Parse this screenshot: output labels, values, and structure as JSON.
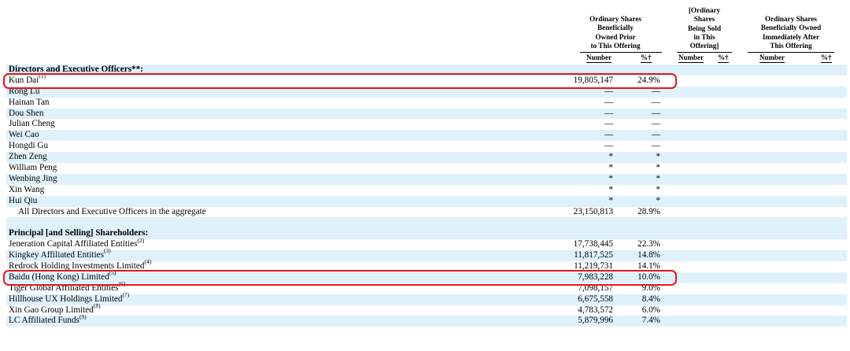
{
  "header": {
    "col1": [
      "Ordinary Shares",
      "Beneficially",
      "Owned Prior",
      "to This Offering"
    ],
    "col2": [
      "[Ordinary",
      "Shares",
      "Being Sold",
      "in This",
      "Offering]"
    ],
    "col3": [
      "Ordinary Shares",
      "Beneficially Owned",
      "Immediately After",
      "This Offering"
    ],
    "sub": {
      "number1": "Number",
      "pct1": "%†",
      "number2": "Number",
      "pct2": "%†",
      "number3": "Number",
      "pct3": "%†"
    }
  },
  "rows": [
    {
      "name": "Directors and Executive Officers**:",
      "sup": "",
      "number": "",
      "pct": "",
      "type": "section",
      "shade": true
    },
    {
      "name": "Kun Dai",
      "sup": "(1)",
      "number": "19,805,147",
      "pct": "24.9%",
      "shade": false,
      "highlight": true
    },
    {
      "name": "Rong Lu",
      "sup": "",
      "number": "—",
      "pct": "—",
      "shade": true
    },
    {
      "name": "Hainan Tan",
      "sup": "",
      "number": "—",
      "pct": "—",
      "shade": false
    },
    {
      "name": "Dou Shen",
      "sup": "",
      "number": "—",
      "pct": "—",
      "shade": true
    },
    {
      "name": "Julian Cheng",
      "sup": "",
      "number": "—",
      "pct": "—",
      "shade": false
    },
    {
      "name": "Wei Cao",
      "sup": "",
      "number": "—",
      "pct": "—",
      "shade": true
    },
    {
      "name": "Hongdi Gu",
      "sup": "",
      "number": "—",
      "pct": "—",
      "shade": false
    },
    {
      "name": "Zhen Zeng",
      "sup": "",
      "number": "*",
      "pct": "*",
      "shade": true
    },
    {
      "name": "William Peng",
      "sup": "",
      "number": "*",
      "pct": "*",
      "shade": false
    },
    {
      "name": "Wenbing Jing",
      "sup": "",
      "number": "*",
      "pct": "*",
      "shade": true
    },
    {
      "name": "Xin Wang",
      "sup": "",
      "number": "*",
      "pct": "*",
      "shade": false
    },
    {
      "name": "Hui Qiu",
      "sup": "",
      "number": "*",
      "pct": "*",
      "shade": true
    },
    {
      "name": "All Directors and Executive Officers in the aggregate",
      "sup": "",
      "number": "23,150,813",
      "pct": "28.9%",
      "shade": false,
      "indent": true
    },
    {
      "name": "",
      "sup": "",
      "number": "",
      "pct": "",
      "shade": true
    },
    {
      "name": "Principal [and Selling] Shareholders:",
      "sup": "",
      "number": "",
      "pct": "",
      "type": "section",
      "shade": true
    },
    {
      "name": "Jeneration Capital Affiliated Entities",
      "sup": "(2)",
      "number": "17,738,445",
      "pct": "22.3%",
      "shade": false
    },
    {
      "name": "Kingkey Affiliated Entities",
      "sup": "(3)",
      "number": "11,817,525",
      "pct": "14.8%",
      "shade": true
    },
    {
      "name": "Redrock Holding Investments Limited",
      "sup": "(4)",
      "number": "11,219,731",
      "pct": "14.1%",
      "shade": false
    },
    {
      "name": "Baidu (Hong Kong) Limited",
      "sup": "(5)",
      "number": "7,983,228",
      "pct": "10.0%",
      "shade": true,
      "highlight": true
    },
    {
      "name": "Tiger Global Affiliated Entities",
      "sup": "(6)",
      "number": "7,098,157",
      "pct": "9.0%",
      "shade": false
    },
    {
      "name": "Hillhouse UX Holdings Limited",
      "sup": "(7)",
      "number": "6,675,558",
      "pct": "8.4%",
      "shade": true
    },
    {
      "name": "Xin Gao Group Limited",
      "sup": "(8)",
      "number": "4,783,572",
      "pct": "6.0%",
      "shade": false
    },
    {
      "name": "LC Affiliated Funds",
      "sup": "(9)",
      "number": "5,879,996",
      "pct": "7.4%",
      "shade": true
    }
  ],
  "colors": {
    "shade": "#dff1fb",
    "highlight": "#e8141a"
  }
}
